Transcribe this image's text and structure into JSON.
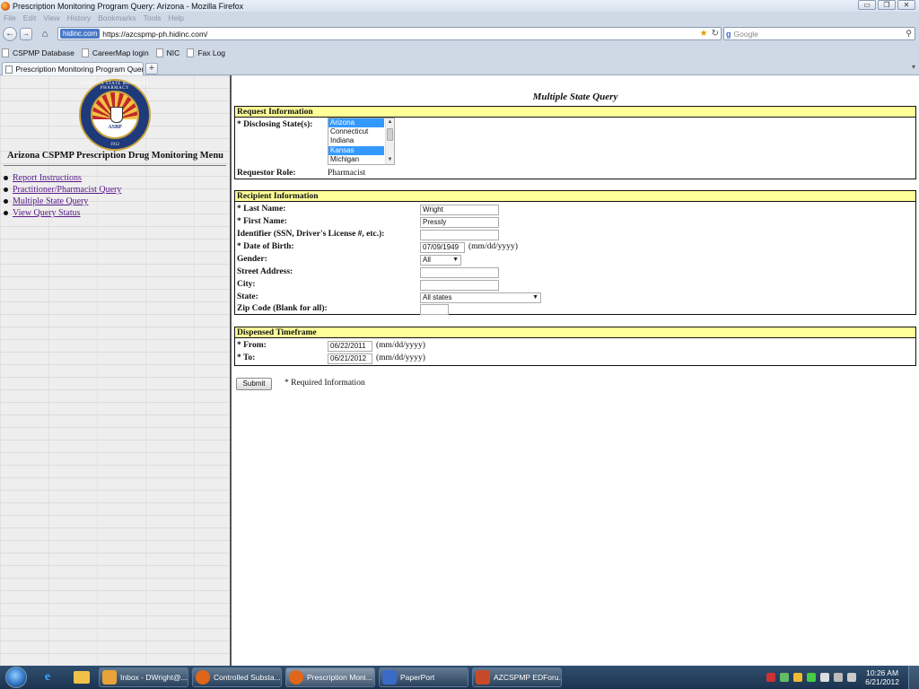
{
  "window": {
    "title": "Prescription Monitoring Program Query: Arizona - Mozilla Firefox",
    "controls": {
      "minimize": "▭",
      "maximize": "❐",
      "close": "✕"
    }
  },
  "menubar": [
    "File",
    "Edit",
    "View",
    "History",
    "Bookmarks",
    "Tools",
    "Help"
  ],
  "navbar": {
    "site_badge": "hidinc.com",
    "url": "https://azcspmp-ph.hidinc.com/",
    "search_placeholder": "Google",
    "icons": [
      "back-icon",
      "forward-icon",
      "home-icon",
      "star-icon",
      "reload-icon",
      "search-icon"
    ]
  },
  "bookmarks": [
    "CSPMP Database",
    "CareerMap login",
    "NIC",
    "Fax Log"
  ],
  "tab": {
    "label": "Prescription Monitoring Program Query:..."
  },
  "sidebar": {
    "seal": {
      "ring_text": "ARIZONA STATE BOARD OF PHARMACY",
      "center_text": "ASBP",
      "year": "1912"
    },
    "menu_title": "Arizona CSPMP  Prescription Drug Monitoring Menu",
    "items": [
      {
        "label": "Report Instructions"
      },
      {
        "label": "Practitioner/Pharmacist Query"
      },
      {
        "label": "Multiple State Query"
      },
      {
        "label": "View Query Status"
      }
    ]
  },
  "main": {
    "title": "Multiple State Query",
    "request": {
      "header": "Request Information",
      "states_label": "* Disclosing State(s):",
      "states": [
        {
          "name": "Arizona",
          "selected": true
        },
        {
          "name": "Connecticut",
          "selected": false
        },
        {
          "name": "Indiana",
          "selected": false
        },
        {
          "name": "Kansas",
          "selected": true
        },
        {
          "name": "Michigan",
          "selected": false
        }
      ],
      "role_label": "Requestor Role:",
      "role_value": "Pharmacist"
    },
    "recipient": {
      "header": "Recipient Information",
      "last_name_label": "* Last Name:",
      "last_name": "Wright",
      "first_name_label": "* First Name:",
      "first_name": "Pressly",
      "identifier_label": "Identifier (SSN, Driver's License #, etc.):",
      "identifier": "",
      "dob_label": "* Date of Birth:",
      "dob": "07/09/1949",
      "dob_hint": "(mm/dd/yyyy)",
      "gender_label": "Gender:",
      "gender": "All",
      "street_label": "Street Address:",
      "street": "",
      "city_label": "City:",
      "city": "",
      "state_label": "State:",
      "state": "All states",
      "zip_label": "Zip Code (Blank for all):",
      "zip": ""
    },
    "timeframe": {
      "header": "Dispensed Timeframe",
      "from_label": "* From:",
      "from": "06/22/2011",
      "from_hint": "(mm/dd/yyyy)",
      "to_label": "* To:",
      "to": "06/21/2012",
      "to_hint": "(mm/dd/yyyy)"
    },
    "submit_label": "Submit",
    "required_note": "* Required Information"
  },
  "taskbar": {
    "tasks": [
      {
        "label": "Inbox - DWright@...",
        "color": "#e8a33a"
      },
      {
        "label": "Controlled Substa...",
        "color": "#e0661a"
      },
      {
        "label": "Prescription Moni...",
        "color": "#e0661a",
        "active": true
      },
      {
        "label": "PaperPort",
        "color": "#3a6bc9"
      },
      {
        "label": "AZCSPMP EDForu...",
        "color": "#c94a2a"
      }
    ],
    "time": "10:26 AM",
    "date": "6/21/2012"
  }
}
